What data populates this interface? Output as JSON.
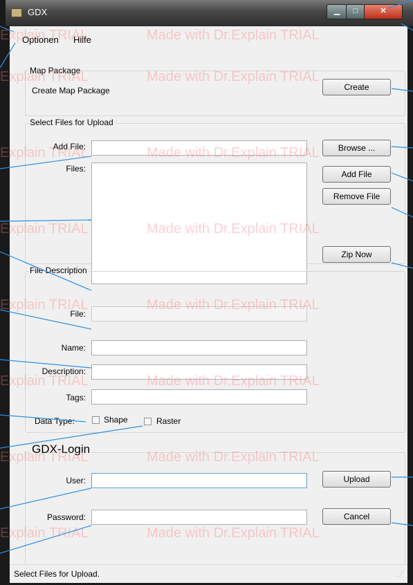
{
  "window": {
    "title": "GDX"
  },
  "menu": {
    "items": [
      "Optionen",
      "Hilfe"
    ]
  },
  "map_package": {
    "group_label": "Map Package",
    "create_label": "Create Map Package",
    "create_button": "Create"
  },
  "upload_files": {
    "group_label": "Select Files for Upload",
    "add_file_label": "Add File:",
    "files_label": "Files:",
    "browse_button": "Browse ...",
    "add_file_button": "Add File",
    "remove_file_button": "Remove File",
    "zip_now_button": "Zip Now"
  },
  "file_description": {
    "group_label": "File Description",
    "file_label": "File:",
    "name_label": "Name:",
    "description_label": "Description:",
    "tags_label": "Tags:",
    "data_type_label": "Data Type:",
    "shape_label": "Shape",
    "raster_label": "Raster"
  },
  "login": {
    "group_label": "GDX-Login",
    "user_label": "User:",
    "password_label": "Password:",
    "upload_button": "Upload",
    "cancel_button": "Cancel"
  },
  "status": {
    "text": "Select Files for Upload."
  },
  "watermark": {
    "text_a": "Explain TRIAL",
    "text_b": "Made with Dr.Explain TRIAL"
  },
  "colors": {
    "callout_line": "#2b8fe6",
    "close_button": "#c0311c"
  }
}
